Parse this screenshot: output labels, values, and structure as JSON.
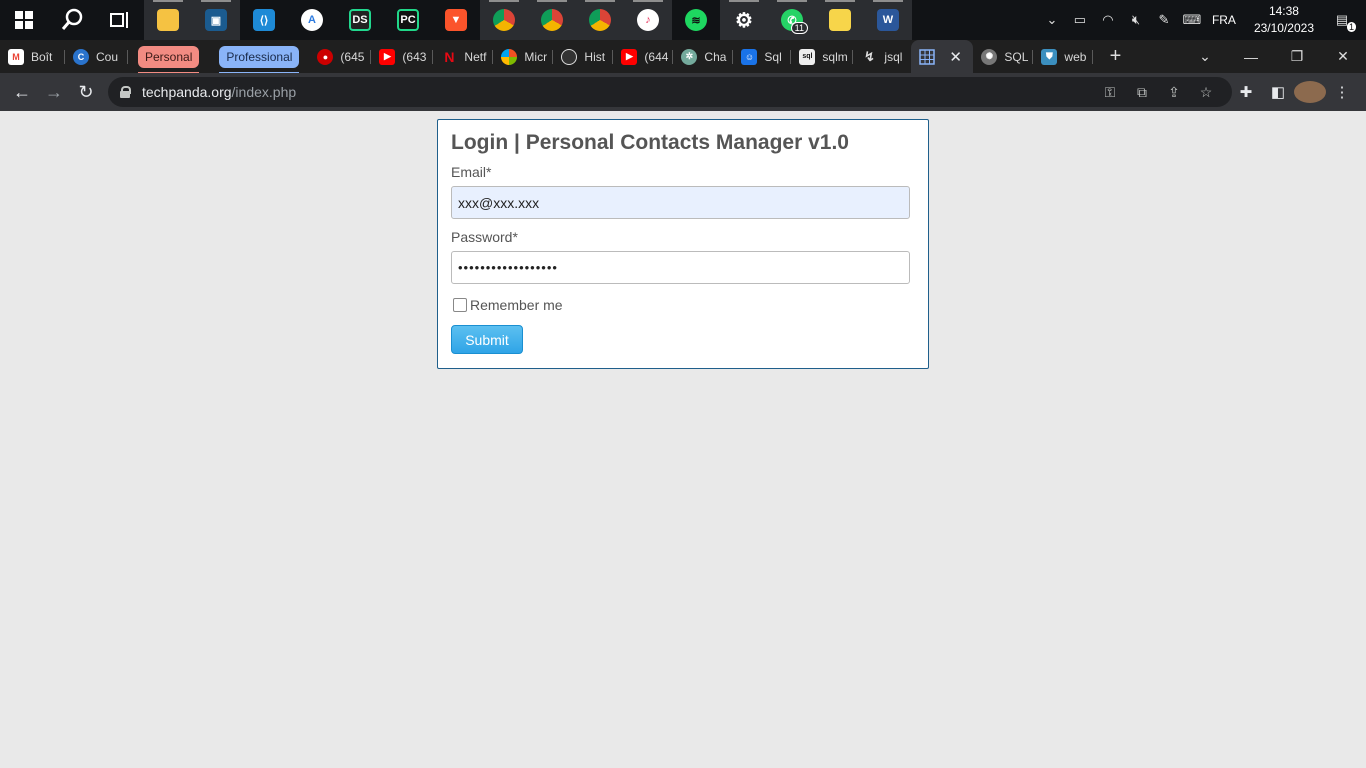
{
  "taskbar": {
    "apps": [
      {
        "icon": "windows-start-icon"
      },
      {
        "icon": "search-icon"
      },
      {
        "icon": "task-view-icon"
      },
      {
        "icon": "file-explorer-icon"
      },
      {
        "icon": "virtualbox-icon"
      },
      {
        "icon": "vscode-icon"
      },
      {
        "icon": "android-studio-icon"
      },
      {
        "icon": "datagrip-icon"
      },
      {
        "icon": "pycharm-icon"
      },
      {
        "icon": "brave-icon"
      },
      {
        "icon": "chrome-profile-1-icon"
      },
      {
        "icon": "chrome-profile-2-icon"
      },
      {
        "icon": "chrome-profile-3-icon"
      },
      {
        "icon": "itunes-icon"
      },
      {
        "icon": "spotify-icon"
      },
      {
        "icon": "settings-icon"
      },
      {
        "icon": "whatsapp-icon",
        "badge": "11"
      },
      {
        "icon": "sticky-notes-icon"
      },
      {
        "icon": "word-icon"
      }
    ],
    "tray": {
      "language": "FRA",
      "time": "14:38",
      "date": "23/10/2023",
      "notification_count": "1"
    }
  },
  "browser": {
    "tabs": [
      {
        "label": "Boît",
        "favicon": "gmail-icon",
        "color": "#ea4335"
      },
      {
        "label": "Cou",
        "favicon": "coursera-icon",
        "color": "#2a73cc"
      }
    ],
    "groups": {
      "personal": "Personal",
      "professional": "Professional"
    },
    "tabs_after": [
      {
        "label": "(645",
        "favicon": "youtube-live-icon",
        "color": "#cc0000"
      },
      {
        "label": "(643",
        "favicon": "youtube-icon",
        "color": "#ff0000"
      },
      {
        "label": "Netf",
        "favicon": "netflix-icon",
        "color": "#e50914"
      },
      {
        "label": "Micr",
        "favicon": "microsoft-icon",
        "color": "#7fba00"
      },
      {
        "label": "Hist",
        "favicon": "history-icon",
        "color": "#666666"
      },
      {
        "label": "(644",
        "favicon": "youtube-icon",
        "color": "#ff0000"
      },
      {
        "label": "Cha",
        "favicon": "chatgpt-icon",
        "color": "#74aa9c"
      },
      {
        "label": "Sql",
        "favicon": "contacts-icon",
        "color": "#1a73e8"
      },
      {
        "label": "sqlm",
        "favicon": "sqlmap-icon",
        "color": "#888888"
      },
      {
        "label": "jsql",
        "favicon": "jsql-icon",
        "color": "#444444"
      }
    ],
    "active_tab": {
      "label": "",
      "favicon": "grid-page-icon",
      "color": "#1a73e8"
    },
    "tabs_end": [
      {
        "label": "SQL",
        "favicon": "gear-spinner-icon",
        "color": "#777777"
      },
      {
        "label": "web",
        "favicon": "shield-icon",
        "color": "#3b8fbf"
      }
    ],
    "url": {
      "host": "techpanda.org",
      "path": "/index.php"
    }
  },
  "login": {
    "title": "Login | Personal Contacts Manager v1.0",
    "email_label": "Email*",
    "email_value": "xxx@xxx.xxx",
    "password_label": "Password*",
    "password_value": "••••••••••••••••••",
    "remember_label": "Remember me",
    "submit_label": "Submit"
  }
}
